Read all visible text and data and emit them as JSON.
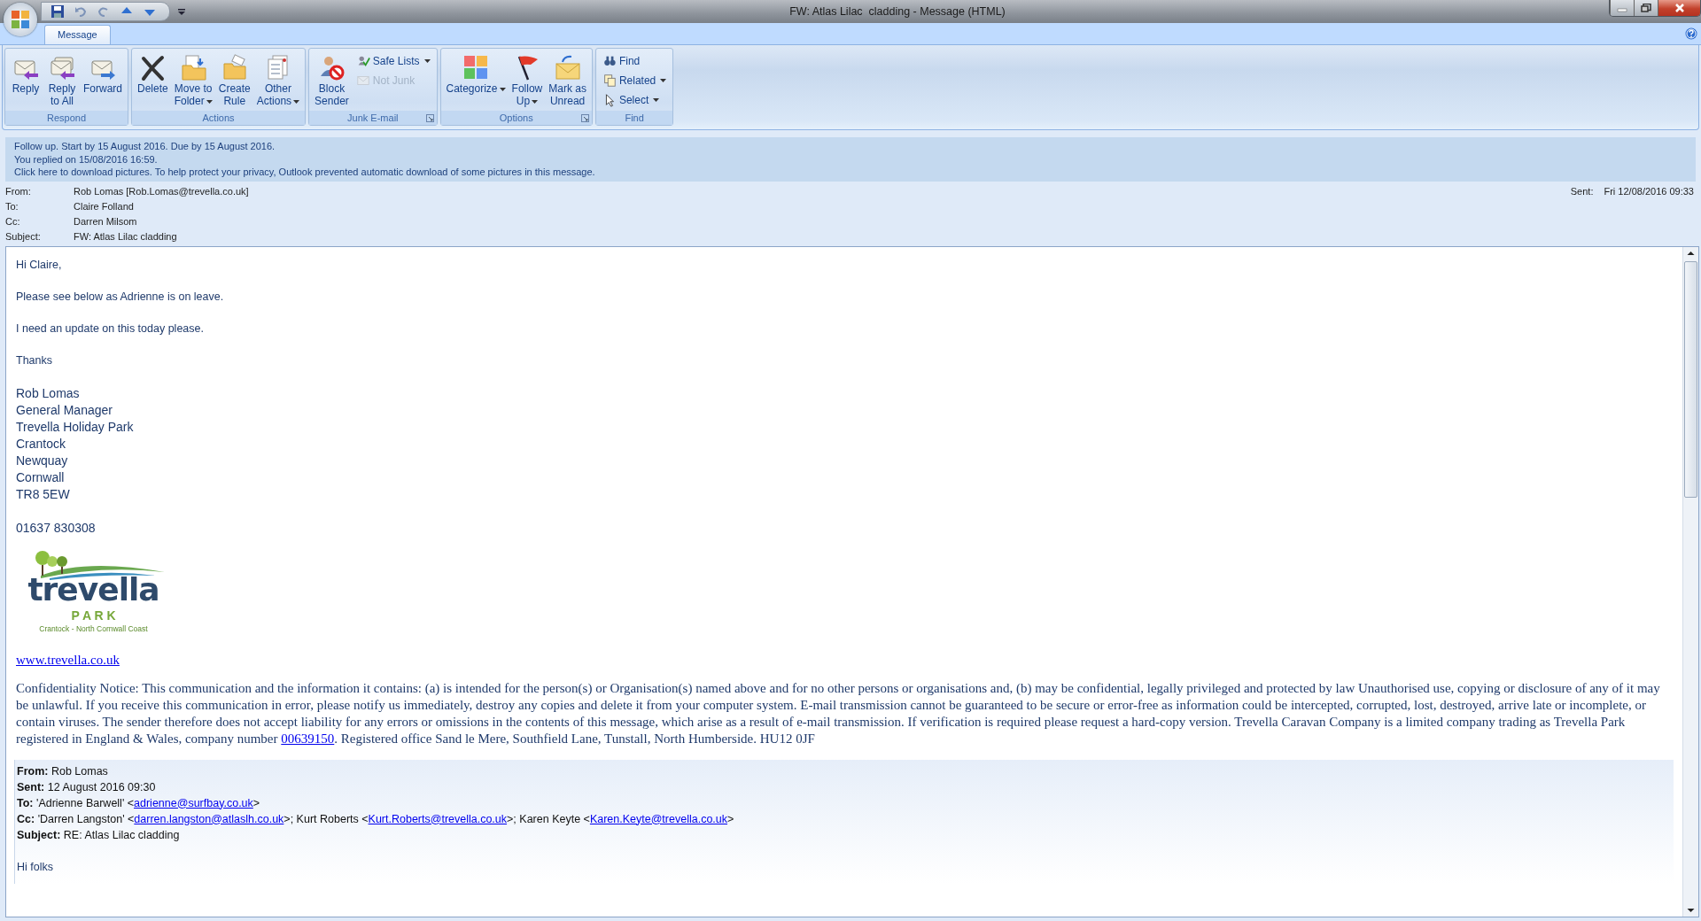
{
  "window": {
    "title": "FW: Atlas Lilac  cladding - Message (HTML)"
  },
  "tabs": [
    {
      "label": "Message",
      "selected": true
    }
  ],
  "ribbon": {
    "groups": [
      {
        "label": "Respond",
        "launcher": false,
        "buttons": [
          {
            "label": "Reply",
            "kind": "large",
            "dropdown": false,
            "disabled": false
          },
          {
            "label": "Reply\nto All",
            "kind": "large",
            "dropdown": false,
            "disabled": false
          },
          {
            "label": "Forward",
            "kind": "large",
            "dropdown": false,
            "disabled": false
          }
        ]
      },
      {
        "label": "Actions",
        "launcher": false,
        "buttons": [
          {
            "label": "Delete",
            "kind": "large",
            "dropdown": false,
            "disabled": false
          },
          {
            "label": "Move to\nFolder",
            "kind": "large",
            "dropdown": true,
            "disabled": false
          },
          {
            "label": "Create\nRule",
            "kind": "large",
            "dropdown": false,
            "disabled": false
          },
          {
            "label": "Other\nActions",
            "kind": "large",
            "dropdown": true,
            "disabled": false
          }
        ]
      },
      {
        "label": "Junk E-mail",
        "launcher": true,
        "buttons": [
          {
            "label": "Block\nSender",
            "kind": "large",
            "dropdown": false,
            "disabled": false
          },
          {
            "label": "Safe Lists",
            "kind": "small",
            "dropdown": true,
            "disabled": false
          },
          {
            "label": "Not Junk",
            "kind": "small",
            "dropdown": false,
            "disabled": true
          }
        ]
      },
      {
        "label": "Options",
        "launcher": true,
        "buttons": [
          {
            "label": "Categorize",
            "kind": "large",
            "dropdown": true,
            "disabled": false
          },
          {
            "label": "Follow\nUp",
            "kind": "large",
            "dropdown": true,
            "disabled": false
          },
          {
            "label": "Mark as\nUnread",
            "kind": "large",
            "dropdown": false,
            "disabled": false
          }
        ]
      },
      {
        "label": "Find",
        "launcher": false,
        "buttons": [
          {
            "label": "Find",
            "kind": "small",
            "dropdown": false,
            "disabled": false
          },
          {
            "label": "Related",
            "kind": "small",
            "dropdown": true,
            "disabled": false
          },
          {
            "label": "Select",
            "kind": "small",
            "dropdown": true,
            "disabled": false
          }
        ]
      }
    ]
  },
  "infobar": [
    "Follow up.  Start by 15 August 2016.  Due by 15 August 2016.",
    "You replied on 15/08/2016 16:59.",
    "Click here to download pictures. To help protect your privacy, Outlook prevented automatic download of some pictures in this message."
  ],
  "header": {
    "fields": [
      {
        "label": "From:",
        "value": "Rob Lomas [Rob.Lomas@trevella.co.uk]"
      },
      {
        "label": "To:",
        "value": "Claire Folland"
      },
      {
        "label": "Cc:",
        "value": "Darren Milsom"
      },
      {
        "label": "Subject:",
        "value": "FW: Atlas Lilac  cladding"
      }
    ],
    "sent": {
      "label": "Sent:",
      "value": "Fri 12/08/2016 09:33"
    }
  },
  "body": {
    "paragraphs": [
      "Hi Claire,",
      "Please see below as Adrienne is on leave.",
      "I need an update on this today please.",
      "Thanks"
    ],
    "signature": [
      "Rob Lomas",
      "General Manager",
      "Trevella Holiday Park",
      "Crantock",
      "Newquay",
      "Cornwall",
      "TR8 5EW"
    ],
    "phone": "01637 830308",
    "logo": {
      "name": "trevella",
      "sub": "P A R K",
      "tagline": "Crantock - North Cornwall Coast"
    },
    "website": "www.trevella.co.uk",
    "notice": [
      {
        "kind": "text",
        "text": "Confidentiality Notice: This communication and the information it contains: (a) is intended for the person(s) or Organisation(s) named above and for no other persons or organisations and, (b) may be confidential, legally privileged and protected by law Unauthorised use, copying or disclosure of any of it may be unlawful. If you receive this communication in error, please notify us immediately, destroy any copies and delete it from your computer system. E-mail transmission cannot be guaranteed to be secure or error-free as information could be intercepted, corrupted, lost, destroyed, arrive late or incomplete, or contain viruses. The sender therefore does not accept liability for any errors or omissions in the contents of this message, which arise as a result of e-mail transmission. If verification is required please request a hard-copy version. Trevella Caravan Company is a limited company trading as Trevella Park registered in England & Wales, company number "
      },
      {
        "kind": "link",
        "text": "00639150"
      },
      {
        "kind": "text",
        "text": ". Registered office Sand le Mere, Southfield Lane, Tunstall, North Humberside. HU12 0JF"
      }
    ],
    "quoted": [
      {
        "label": "From:",
        "parts": [
          {
            "kind": "text",
            "text": "Rob Lomas"
          }
        ]
      },
      {
        "label": "Sent:",
        "parts": [
          {
            "kind": "text",
            "text": "12 August 2016 09:30"
          }
        ]
      },
      {
        "label": "To:",
        "parts": [
          {
            "kind": "text",
            "text": "'Adrienne Barwell' <"
          },
          {
            "kind": "link",
            "text": "adrienne@surfbay.co.uk"
          },
          {
            "kind": "text",
            "text": ">"
          }
        ]
      },
      {
        "label": "Cc:",
        "parts": [
          {
            "kind": "text",
            "text": "'Darren Langston' <"
          },
          {
            "kind": "link",
            "text": "darren.langston@atlaslh.co.uk"
          },
          {
            "kind": "text",
            "text": ">; Kurt Roberts <"
          },
          {
            "kind": "link",
            "text": "Kurt.Roberts@trevella.co.uk"
          },
          {
            "kind": "text",
            "text": ">; Karen Keyte <"
          },
          {
            "kind": "link",
            "text": "Karen.Keyte@trevella.co.uk"
          },
          {
            "kind": "text",
            "text": ">"
          }
        ]
      },
      {
        "label": "Subject:",
        "parts": [
          {
            "kind": "text",
            "text": "RE: Atlas Lilac cladding"
          }
        ]
      }
    ],
    "quoted_body": "Hi folks"
  }
}
